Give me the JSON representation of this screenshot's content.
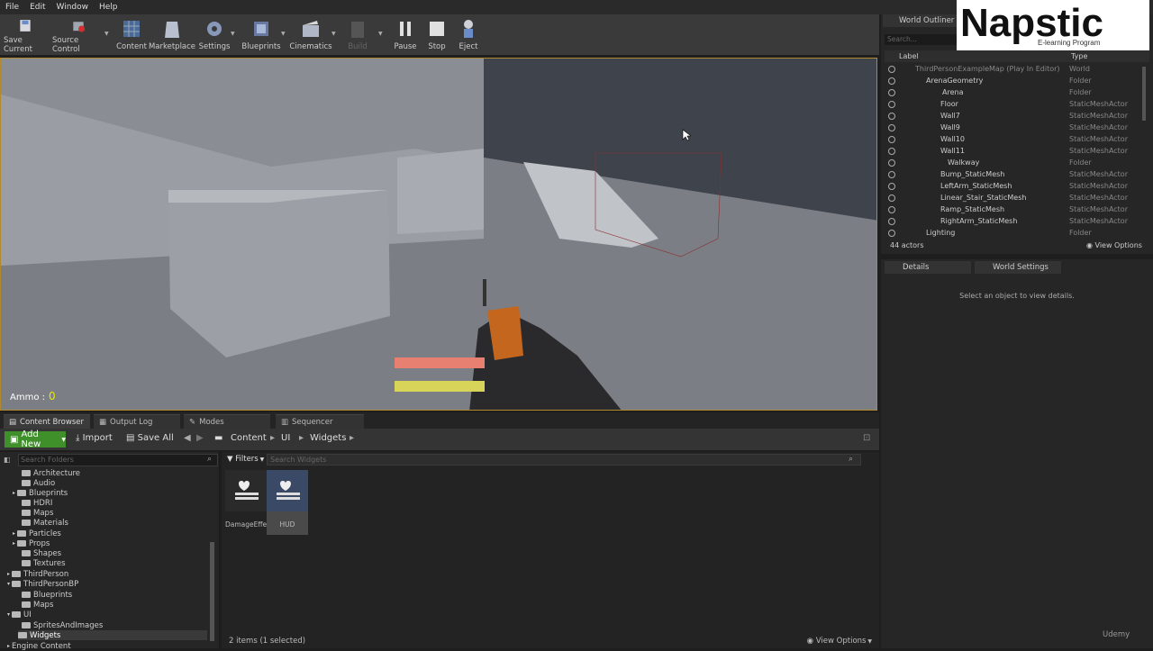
{
  "menu": [
    "File",
    "Edit",
    "Window",
    "Help"
  ],
  "toolbar": {
    "items": [
      {
        "label": "Save Current",
        "icon": "save-icon"
      },
      {
        "label": "Source Control",
        "icon": "source-control-icon"
      },
      {
        "label": "Content",
        "icon": "content-icon"
      },
      {
        "label": "Marketplace",
        "icon": "marketplace-icon"
      },
      {
        "label": "Settings",
        "icon": "settings-icon"
      },
      {
        "label": "Blueprints",
        "icon": "blueprints-icon"
      },
      {
        "label": "Cinematics",
        "icon": "cinematics-icon"
      },
      {
        "label": "Build",
        "icon": "build-icon"
      },
      {
        "label": "Pause",
        "icon": "pause-icon"
      },
      {
        "label": "Stop",
        "icon": "stop-icon"
      },
      {
        "label": "Eject",
        "icon": "eject-icon"
      }
    ]
  },
  "viewport": {
    "ammo_label": "Ammo :",
    "ammo_value": "0",
    "health_color": "#e88072",
    "stamina_color": "#d8d45a"
  },
  "bottom_tabs": [
    "Content Browser",
    "Output Log",
    "Modes",
    "Sequencer"
  ],
  "content_browser": {
    "add_new": "Add New",
    "import": "Import",
    "save_all": "Save All",
    "breadcrumb": [
      "Content",
      "UI",
      "Widgets"
    ],
    "folder_search_placeholder": "Search Folders",
    "asset_search_placeholder": "Search Widgets",
    "filters": "Filters",
    "folders": [
      "Architecture",
      "Audio",
      "Blueprints",
      "HDRI",
      "Maps",
      "Materials",
      "Particles",
      "Props",
      "Shapes",
      "Textures",
      "ThirdPerson",
      "ThirdPersonBP",
      "Blueprints",
      "Maps",
      "UI",
      "SpritesAndImages",
      "Widgets",
      "Engine Content"
    ],
    "assets": [
      {
        "name": "DamageEffect"
      },
      {
        "name": "HUD"
      }
    ],
    "status": "2 items (1 selected)",
    "view_options": "View Options"
  },
  "outliner": {
    "tab": "World Outliner",
    "search_placeholder": "Search...",
    "col_label": "Label",
    "col_type": "Type",
    "rows": [
      {
        "label": "ThirdPersonExampleMap (Play In Editor)",
        "type": "World"
      },
      {
        "label": "ArenaGeometry",
        "type": "Folder"
      },
      {
        "label": "Arena",
        "type": "Folder"
      },
      {
        "label": "Floor",
        "type": "StaticMeshActor"
      },
      {
        "label": "Wall7",
        "type": "StaticMeshActor"
      },
      {
        "label": "Wall9",
        "type": "StaticMeshActor"
      },
      {
        "label": "Wall10",
        "type": "StaticMeshActor"
      },
      {
        "label": "Wall11",
        "type": "StaticMeshActor"
      },
      {
        "label": "Walkway",
        "type": "Folder"
      },
      {
        "label": "Bump_StaticMesh",
        "type": "StaticMeshActor"
      },
      {
        "label": "LeftArm_StaticMesh",
        "type": "StaticMeshActor"
      },
      {
        "label": "Linear_Stair_StaticMesh",
        "type": "StaticMeshActor"
      },
      {
        "label": "Ramp_StaticMesh",
        "type": "StaticMeshActor"
      },
      {
        "label": "RightArm_StaticMesh",
        "type": "StaticMeshActor"
      },
      {
        "label": "Lighting",
        "type": "Folder"
      }
    ],
    "actor_count": "44 actors",
    "view_options": "View Options"
  },
  "details": {
    "tabs": [
      "Details",
      "World Settings"
    ],
    "message": "Select an object to view details."
  },
  "logo": {
    "brand": "Napstic",
    "tagline": "E-learning Program"
  },
  "watermark": "Udemy"
}
